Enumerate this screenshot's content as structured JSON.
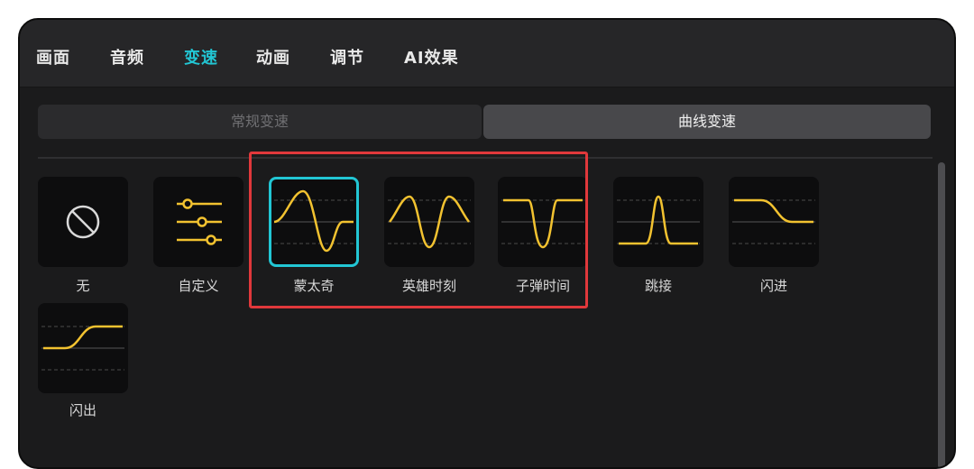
{
  "tabs": [
    "画面",
    "音频",
    "变速",
    "动画",
    "调节",
    "AI效果"
  ],
  "active_tab": "变速",
  "segment": {
    "normal_label": "常规变速",
    "curve_label": "曲线变速",
    "selected": "曲线变速"
  },
  "presets": [
    {
      "label": "无",
      "icon": "none-icon"
    },
    {
      "label": "自定义",
      "icon": "custom-sliders-icon"
    },
    {
      "label": "蒙太奇",
      "icon": "montage-curve-icon",
      "selected": true
    },
    {
      "label": "英雄时刻",
      "icon": "hero-moment-curve-icon"
    },
    {
      "label": "子弹时间",
      "icon": "bullet-time-curve-icon"
    },
    {
      "label": "跳接",
      "icon": "jump-cut-curve-icon"
    },
    {
      "label": "闪进",
      "icon": "flash-in-curve-icon"
    },
    {
      "label": "闪出",
      "icon": "flash-out-curve-icon"
    }
  ],
  "colors": {
    "accent": "#22c6d4",
    "curve": "#f2c230",
    "highlight_box": "#e0383b"
  }
}
